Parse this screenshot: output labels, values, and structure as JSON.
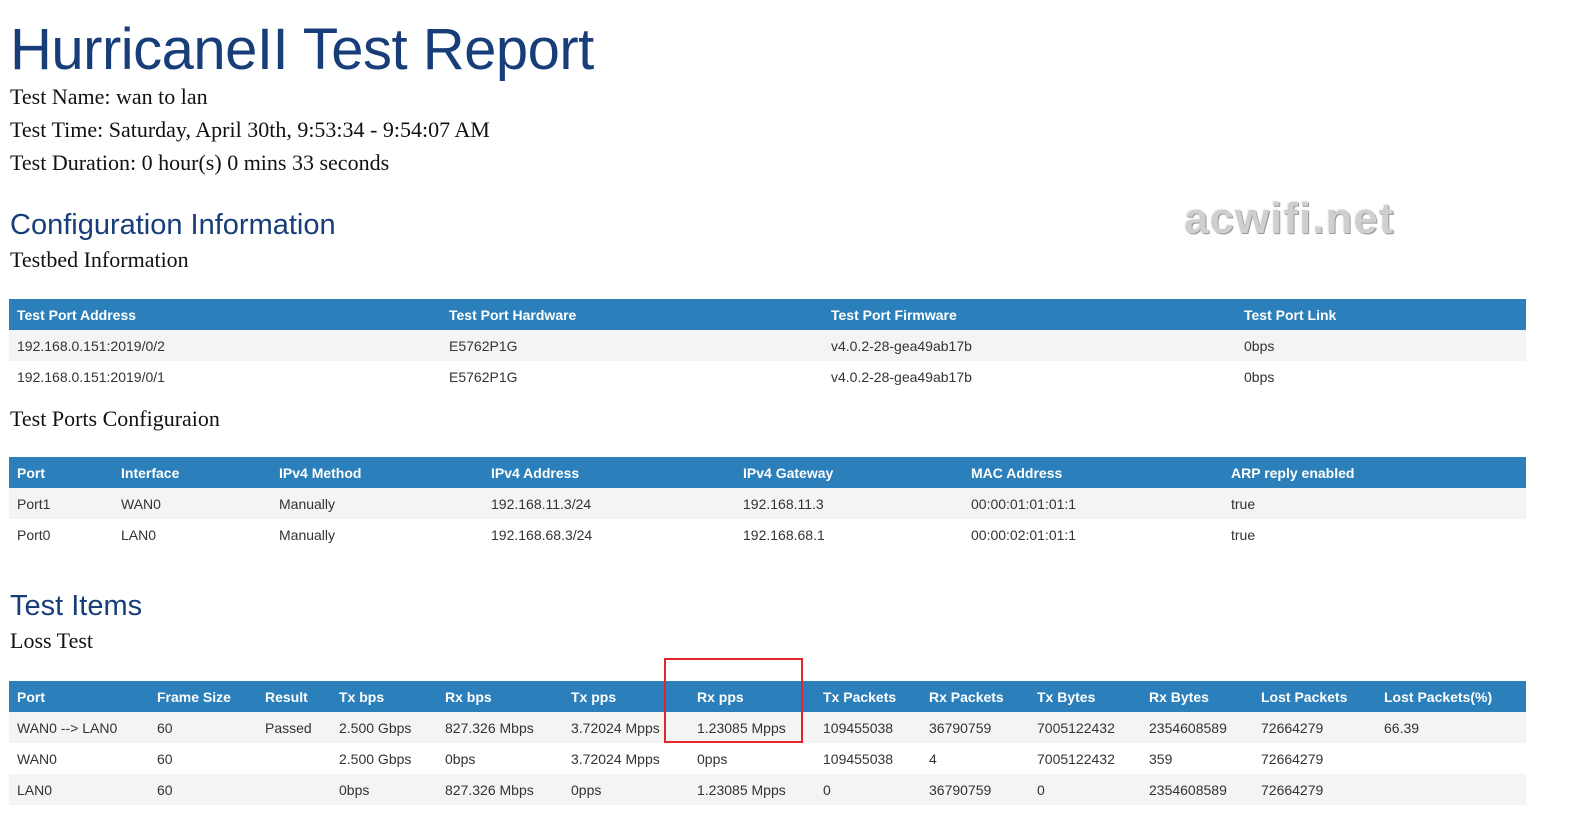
{
  "report": {
    "title": "HurricaneII Test Report",
    "test_name": "Test Name: wan to lan",
    "test_time": "Test Time: Saturday, April 30th, 9:53:34 - 9:54:07 AM",
    "test_duration": "Test Duration: 0 hour(s) 0 mins 33 seconds"
  },
  "watermark": "acwifi.net",
  "config": {
    "heading": "Configuration Information",
    "testbed_heading": "Testbed Information",
    "testbed_table": {
      "headers": [
        "Test Port Address",
        "Test Port Hardware",
        "Test Port Firmware",
        "Test Port Link"
      ],
      "rows": [
        [
          "192.168.0.151:2019/0/2",
          "E5762P1G",
          "v4.0.2-28-gea49ab17b",
          "0bps"
        ],
        [
          "192.168.0.151:2019/0/1",
          "E5762P1G",
          "v4.0.2-28-gea49ab17b",
          "0bps"
        ]
      ]
    },
    "ports_heading": "Test Ports Configuraion",
    "ports_table": {
      "headers": [
        "Port",
        "Interface",
        "IPv4 Method",
        "IPv4 Address",
        "IPv4 Gateway",
        "MAC Address",
        "ARP reply enabled"
      ],
      "rows": [
        [
          "Port1",
          "WAN0",
          "Manually",
          "192.168.11.3/24",
          "192.168.11.3",
          "00:00:01:01:01:1",
          "true"
        ],
        [
          "Port0",
          "LAN0",
          "Manually",
          "192.168.68.3/24",
          "192.168.68.1",
          "00:00:02:01:01:1",
          "true"
        ]
      ]
    }
  },
  "items": {
    "heading": "Test Items",
    "loss_heading": "Loss Test",
    "loss_table": {
      "headers": [
        "Port",
        "Frame Size",
        "Result",
        "Tx bps",
        "Rx bps",
        "Tx pps",
        "Rx pps",
        "Tx Packets",
        "Rx Packets",
        "Tx Bytes",
        "Rx Bytes",
        "Lost Packets",
        "Lost Packets(%)"
      ],
      "rows": [
        [
          "WAN0 --> LAN0",
          "60",
          "Passed",
          "2.500 Gbps",
          "827.326 Mbps",
          "3.72024 Mpps",
          "1.23085 Mpps",
          "109455038",
          "36790759",
          "7005122432",
          "2354608589",
          "72664279",
          "66.39"
        ],
        [
          "WAN0",
          "60",
          "",
          "2.500 Gbps",
          "0bps",
          "3.72024 Mpps",
          "0pps",
          "109455038",
          "4",
          "7005122432",
          "359",
          "72664279",
          ""
        ],
        [
          "LAN0",
          "60",
          "",
          "0bps",
          "827.326 Mbps",
          "0pps",
          "1.23085 Mpps",
          "0",
          "36790759",
          "0",
          "2354608589",
          "72664279",
          ""
        ]
      ],
      "highlighted_column": "Rx pps"
    }
  },
  "colors": {
    "heading": "#173e79",
    "table_header": "#2b7fba",
    "highlight_box": "#e0262c"
  }
}
